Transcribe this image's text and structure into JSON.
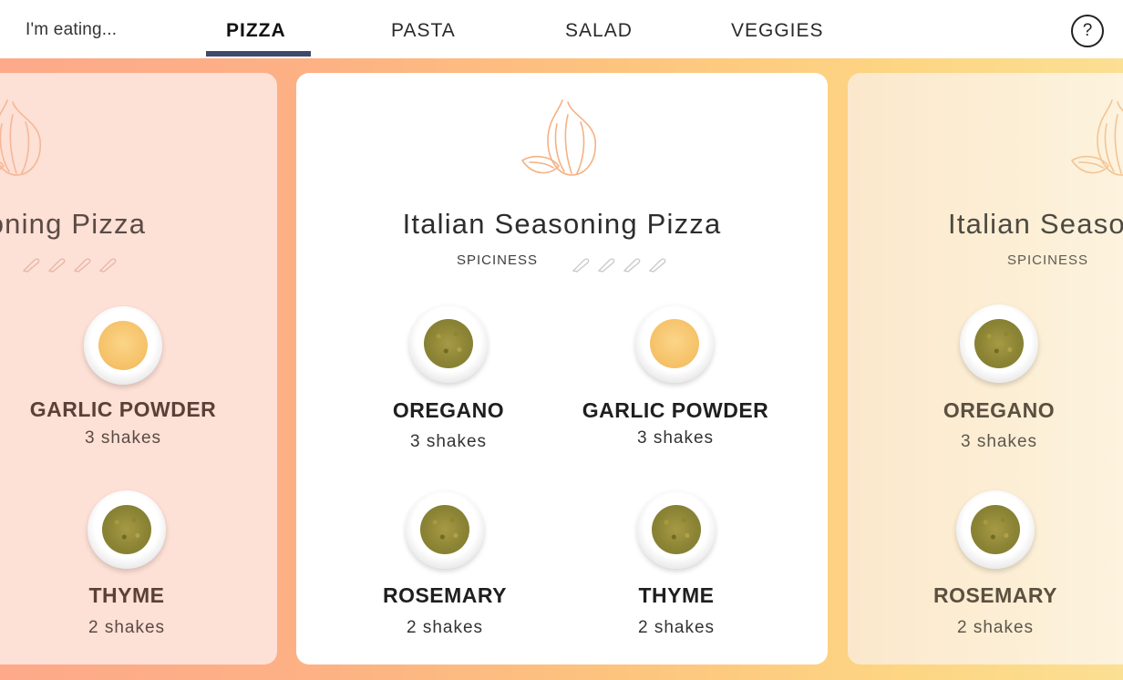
{
  "header": {
    "prompt": "I'm eating...",
    "tabs": [
      {
        "label": "PIZZA",
        "active": true
      },
      {
        "label": "PASTA",
        "active": false
      },
      {
        "label": "SALAD",
        "active": false
      },
      {
        "label": "VEGGIES",
        "active": false
      }
    ],
    "help_label": "?"
  },
  "colors": {
    "accent": "#3e4a6b",
    "gradient_start": "#fda98a",
    "gradient_end": "#fbdf92",
    "garlic_outline": "#f7b98a"
  },
  "cards": {
    "left": {
      "title_visible": "soning Pizza",
      "spiciness_level": 0,
      "spices": [
        {
          "name": "GARLIC POWDER",
          "amount": "3 shakes",
          "icon": "garlic-powder-bowl-icon"
        },
        {
          "name": "THYME",
          "amount": "2 shakes",
          "icon": "thyme-bowl-icon"
        }
      ]
    },
    "center": {
      "title": "Italian Seasoning Pizza",
      "spiciness_label": "SPICINESS",
      "spiciness_level": 0,
      "spiciness_max": 4,
      "spices": [
        {
          "name": "OREGANO",
          "amount": "3 shakes",
          "icon": "oregano-bowl-icon"
        },
        {
          "name": "GARLIC POWDER",
          "amount": "3 shakes",
          "icon": "garlic-powder-bowl-icon"
        },
        {
          "name": "ROSEMARY",
          "amount": "2 shakes",
          "icon": "rosemary-bowl-icon"
        },
        {
          "name": "THYME",
          "amount": "2 shakes",
          "icon": "thyme-bowl-icon"
        }
      ]
    },
    "right": {
      "title_visible": "Italian Seaso",
      "spiciness_label": "SPICINESS",
      "spices": [
        {
          "name": "OREGANO",
          "amount": "3 shakes",
          "icon": "oregano-bowl-icon"
        },
        {
          "name": "ROSEMARY",
          "amount": "2 shakes",
          "icon": "rosemary-bowl-icon"
        }
      ]
    }
  }
}
